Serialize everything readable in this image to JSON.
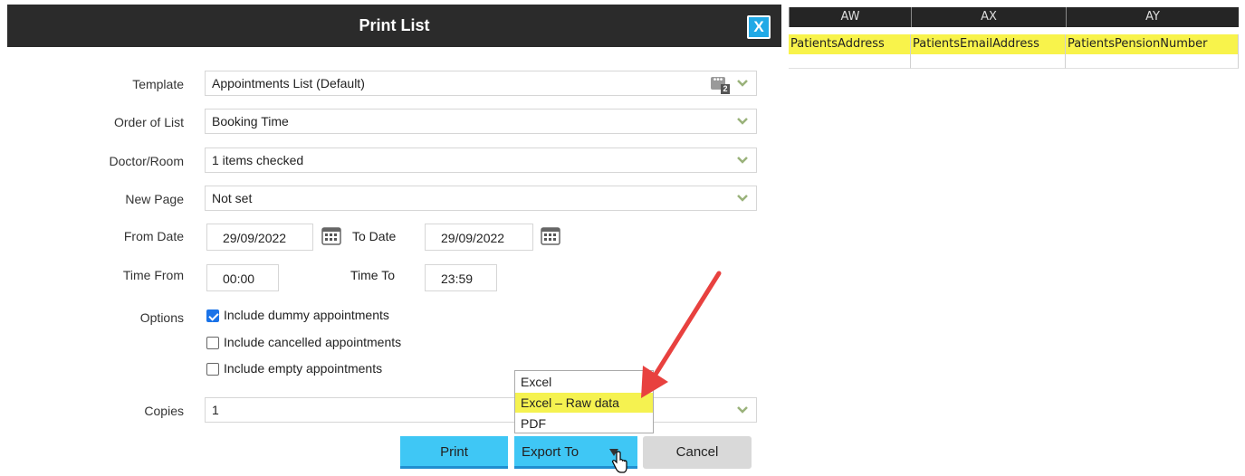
{
  "dialog": {
    "title": "Print List",
    "close_label": "X"
  },
  "fields": {
    "template": {
      "label": "Template",
      "value": "Appointments List (Default)",
      "badge_count": "2"
    },
    "order": {
      "label": "Order of List",
      "value": "Booking Time"
    },
    "doctor": {
      "label": "Doctor/Room",
      "value": "1 items checked"
    },
    "new_page": {
      "label": "New Page",
      "value": "Not set"
    },
    "from_date": {
      "label": "From Date",
      "value": "29/09/2022"
    },
    "to_date": {
      "label": "To Date",
      "value": "29/09/2022"
    },
    "time_from": {
      "label": "Time From",
      "value": "00:00"
    },
    "time_to": {
      "label": "Time To",
      "value": "23:59"
    },
    "options": {
      "label": "Options",
      "items": [
        {
          "label": "Include dummy appointments",
          "checked": true
        },
        {
          "label": "Include cancelled appointments",
          "checked": false
        },
        {
          "label": "Include empty appointments",
          "checked": false
        }
      ]
    },
    "copies": {
      "label": "Copies",
      "value": "1"
    }
  },
  "buttons": {
    "print": "Print",
    "export": "Export To",
    "cancel": "Cancel"
  },
  "export_menu": {
    "items": [
      "Excel",
      "Excel – Raw data",
      "PDF"
    ],
    "highlighted_index": 1
  },
  "spreadsheet": {
    "columns": [
      "AW",
      "AX",
      "AY"
    ],
    "cells": [
      "PatientsAddress",
      "PatientsEmailAddress",
      "PatientsPensionNumber"
    ]
  },
  "colors": {
    "accent": "#3fc7f5",
    "highlight": "#f5f250",
    "titlebar": "#2b2b2b",
    "arrow": "#e8413f"
  }
}
